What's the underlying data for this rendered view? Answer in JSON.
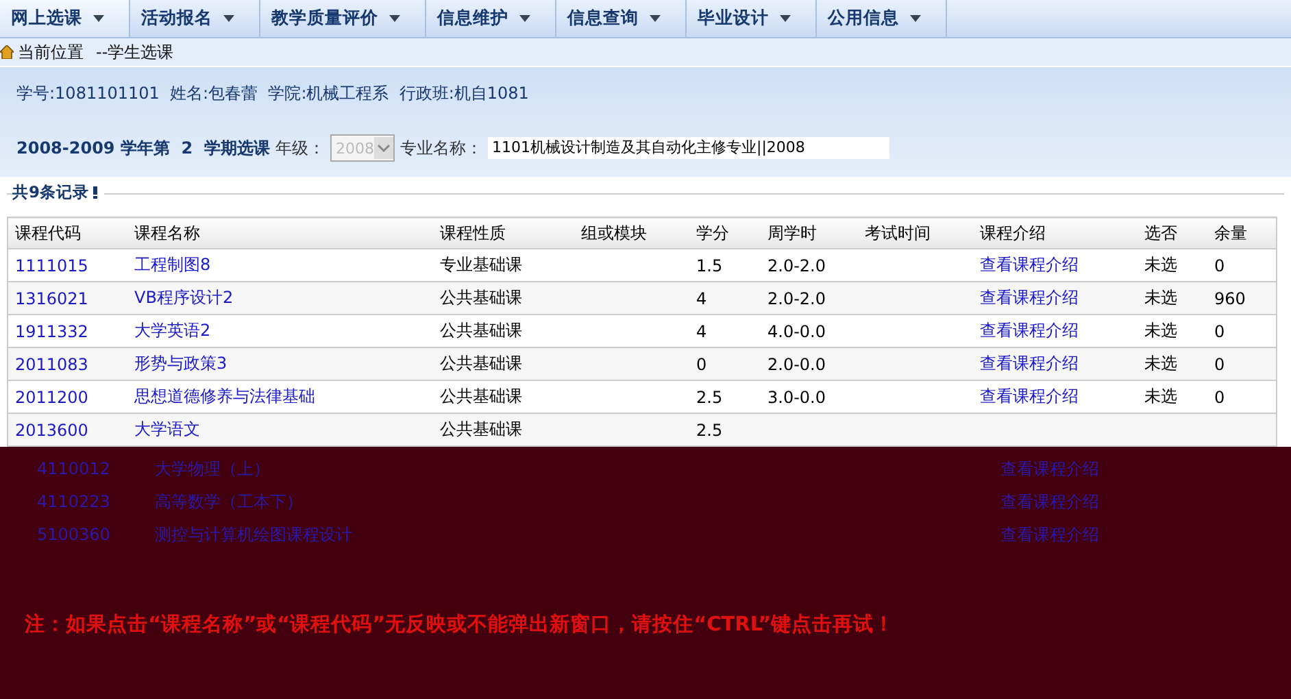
{
  "nav": [
    {
      "label": "网上选课",
      "selected": true
    },
    {
      "label": "活动报名",
      "selected": false
    },
    {
      "label": "教学质量评价",
      "selected": false
    },
    {
      "label": "信息维护",
      "selected": false
    },
    {
      "label": "信息查询",
      "selected": false
    },
    {
      "label": "毕业设计",
      "selected": false
    },
    {
      "label": "公用信息",
      "selected": false
    }
  ],
  "breadcrumb": {
    "label": "当前位置",
    "path": "--学生选课"
  },
  "student_info": "学号:1081101101  姓名:包春蕾  学院:机械工程系  行政班:机自1081",
  "term": {
    "text": "2008-2009 学年第  2  学期选课",
    "grade_label": "年级：",
    "grade": "2008",
    "grade_disabled": true,
    "major_label": "专业名称：",
    "major": "1101机械设计制造及其自动化主修专业||2008"
  },
  "records_title": "共9条记录",
  "table": {
    "columns": [
      "课程代码",
      "课程名称",
      "课程性质",
      "组或模块",
      "学分",
      "周学时",
      "考试时间",
      "课程介绍",
      "选否",
      "余量"
    ],
    "rows": [
      {
        "cells": [
          "1111015",
          "工程制图8",
          "专业基础课",
          "",
          "1.5",
          "2.0-2.0",
          "",
          "查看课程介绍",
          "未选",
          "0"
        ]
      },
      {
        "cells": [
          "1316021",
          "VB程序设计2",
          "公共基础课",
          "",
          "4",
          "2.0-2.0",
          "",
          "查看课程介绍",
          "未选",
          "960"
        ]
      },
      {
        "cells": [
          "1911332",
          "大学英语2",
          "公共基础课",
          "",
          "4",
          "4.0-0.0",
          "",
          "查看课程介绍",
          "未选",
          "0"
        ]
      },
      {
        "cells": [
          "2011083",
          "形势与政策3",
          "公共基础课",
          "",
          "0",
          "2.0-0.0",
          "",
          "查看课程介绍",
          "未选",
          "0"
        ]
      },
      {
        "cells": [
          "2011200",
          "思想道德修养与法律基础",
          "公共基础课",
          "",
          "2.5",
          "3.0-0.0",
          "",
          "查看课程介绍",
          "未选",
          "0"
        ]
      },
      {
        "cells": [
          "2013600",
          "大学语文",
          "公共基础课",
          "",
          "2.5",
          "",
          "",
          "",
          "",
          ""
        ]
      }
    ]
  },
  "covered_rows": [
    {
      "code": "4110012",
      "name": "大学物理（上）",
      "link": "查看课程介绍"
    },
    {
      "code": "4110223",
      "name": "高等数学（工本下）",
      "link": "查看课程介绍"
    },
    {
      "code": "5100360",
      "name": "测控与计算机绘图课程设计",
      "link": "查看课程介绍"
    }
  ],
  "notice": "注：如果点击“课程名称”或“课程代码”无反映或不能弹出新窗口，请按住“CTRL”键点击再试！"
}
